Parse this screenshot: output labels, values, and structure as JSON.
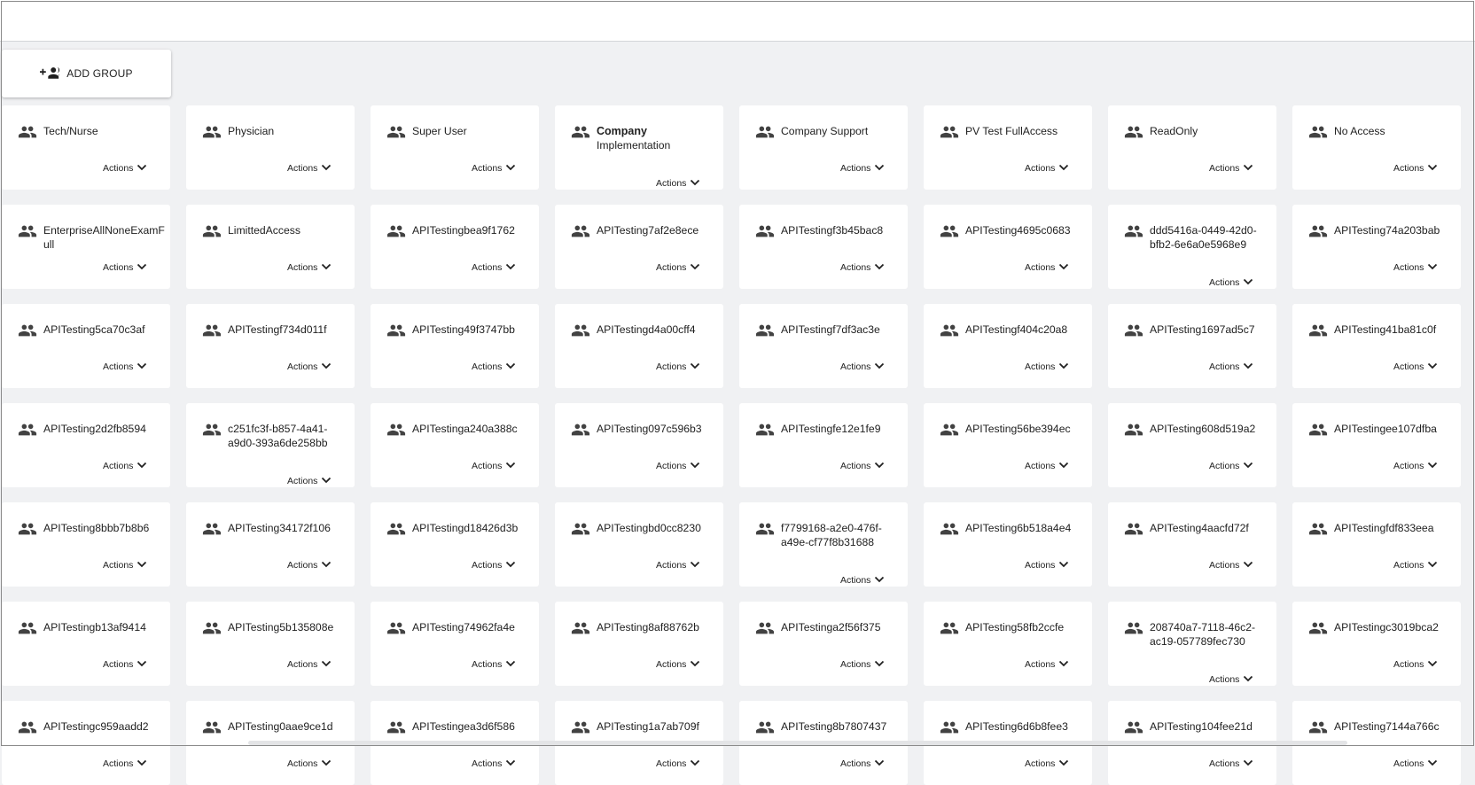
{
  "toolbar": {
    "add_group_label": "ADD GROUP"
  },
  "actions_label": "Actions",
  "groups": [
    "Tech/Nurse",
    "Physician",
    "Super User",
    "Company\nImplementation",
    "Company Support",
    "PV Test FullAccess",
    "ReadOnly",
    "No Access",
    "EnterpriseAllNoneExamFull",
    "LimittedAccess",
    "APITestingbea9f1762",
    "APITesting7af2e8ece",
    "APITestingf3b45bac8",
    "APITesting4695c0683",
    "ddd5416a-0449-42d0-\nbfb2-6e6a0e5968e9",
    "APITesting74a203bab",
    "APITesting5ca70c3af",
    "APITestingf734d011f",
    "APITesting49f3747bb",
    "APITestingd4a00cff4",
    "APITestingf7df3ac3e",
    "APITestingf404c20a8",
    "APITesting1697ad5c7",
    "APITesting41ba81c0f",
    "APITesting2d2fb8594",
    "c251fc3f-b857-4a41-\na9d0-393a6de258bb",
    "APITestinga240a388c",
    "APITesting097c596b3",
    "APITestingfe12e1fe9",
    "APITesting56be394ec",
    "APITesting608d519a2",
    "APITestingee107dfba",
    "APITesting8bbb7b8b6",
    "APITesting34172f106",
    "APITestingd18426d3b",
    "APITestingbd0cc8230",
    "f7799168-a2e0-476f-\na49e-cf77f8b31688",
    "APITesting6b518a4e4",
    "APITesting4aacfd72f",
    "APITestingfdf833eea",
    "APITestingb13af9414",
    "APITesting5b135808e",
    "APITesting74962fa4e",
    "APITesting8af88762b",
    "APITestinga2f56f375",
    "APITesting58fb2ccfe",
    "208740a7-7118-46c2-\nac19-057789fec730",
    "APITestingc3019bca2",
    "APITestingc959aadd2",
    "APITesting0aae9ce1d",
    "APITestingea3d6f586",
    "APITesting1a7ab709f",
    "APITesting8b7807437",
    "APITesting6d6b8fee3",
    "APITesting104fee21d",
    "APITesting7144a766c"
  ]
}
